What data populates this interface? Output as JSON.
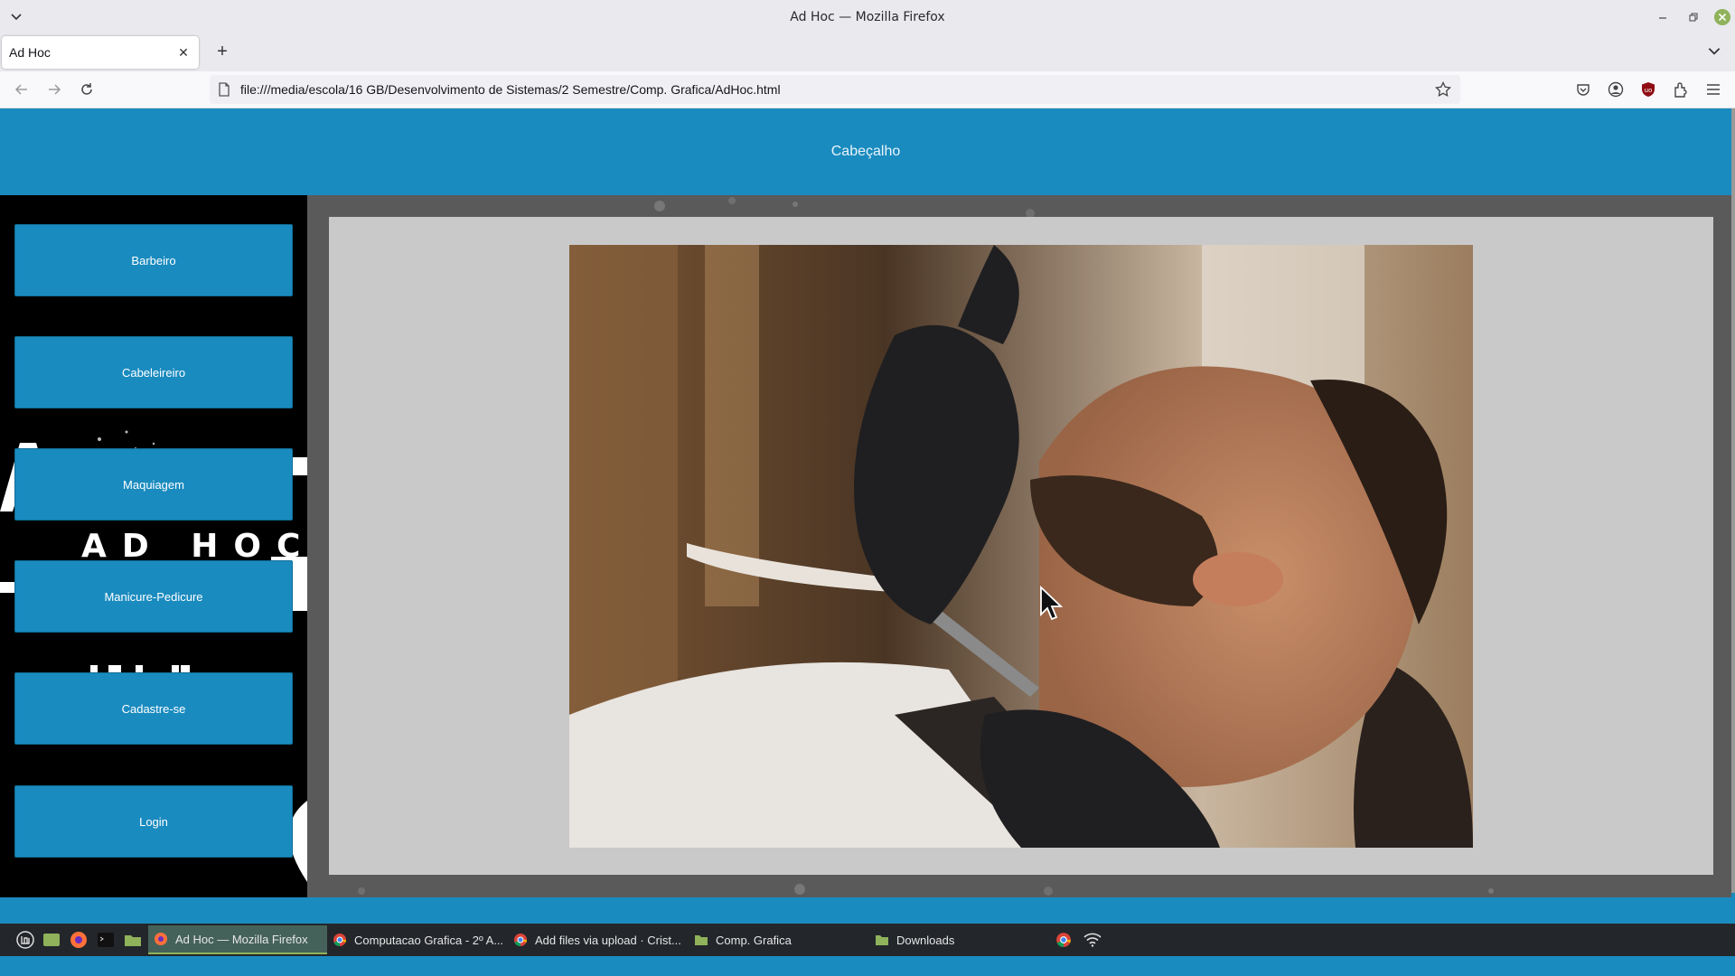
{
  "window": {
    "title": "Ad Hoc — Mozilla Firefox"
  },
  "tabs": [
    {
      "label": "Ad Hoc",
      "active": true
    }
  ],
  "navbar": {
    "url": "file:///media/escola/16 GB/Desenvolvimento de Sistemas/2 Semestre/Comp. Grafica/AdHoc.html"
  },
  "page": {
    "header_text": "Cabeçalho",
    "menu": [
      {
        "label": "Barbeiro"
      },
      {
        "label": "Cabeleireiro"
      },
      {
        "label": "Maquiagem"
      },
      {
        "label": "Manicure-Pedicure"
      },
      {
        "label": "Cadastre-se"
      },
      {
        "label": "Login"
      }
    ],
    "logo_text": "AD HOC",
    "accent_color": "#1a8bbf"
  },
  "taskbar": {
    "windows": [
      {
        "label": "Ad Hoc — Mozilla Firefox",
        "active": true
      },
      {
        "label": "Computacao Grafica - 2º A..."
      },
      {
        "label": "Add files via upload · Crist..."
      },
      {
        "label": "Comp. Grafica"
      },
      {
        "label": "Downloads"
      }
    ]
  }
}
